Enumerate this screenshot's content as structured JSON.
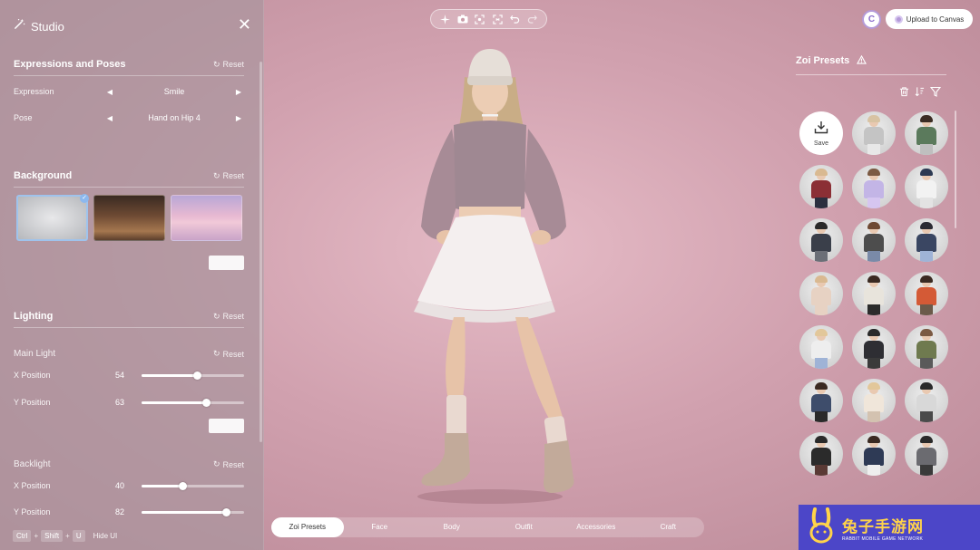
{
  "studio": {
    "title": "Studio",
    "sections": {
      "expressions": {
        "title": "Expressions and Poses",
        "reset": "Reset",
        "expression_label": "Expression",
        "expression_value": "Smile",
        "pose_label": "Pose",
        "pose_value": "Hand on Hip 4"
      },
      "background": {
        "title": "Background",
        "reset": "Reset"
      },
      "lighting": {
        "title": "Lighting",
        "reset": "Reset",
        "main_light": {
          "title": "Main Light",
          "reset": "Reset",
          "x_label": "X Position",
          "x_value": 54,
          "y_label": "Y Position",
          "y_value": 63
        },
        "backlight": {
          "title": "Backlight",
          "reset": "Reset",
          "x_label": "X Position",
          "x_value": 40,
          "y_label": "Y Position",
          "y_value": 82
        }
      }
    },
    "shortcuts": {
      "keys": [
        "Ctrl",
        "Shift",
        "U"
      ],
      "plus": "+",
      "label": "Hide UI"
    }
  },
  "header": {
    "avatar_letter": "C",
    "upload_label": "Upload to Canvas"
  },
  "presets": {
    "title": "Zoi Presets",
    "save_label": "Save",
    "items": [
      {
        "hair": "#d8c3a3",
        "top": "#c4c4c4",
        "bottom": "#e8e8e8"
      },
      {
        "hair": "#3b2c24",
        "top": "#5b7a5c",
        "bottom": "#bfbfbf"
      },
      {
        "hair": "#d9b991",
        "top": "#8b2f35",
        "bottom": "#2b2f3f"
      },
      {
        "hair": "#7b5a43",
        "top": "#c3b5e6",
        "bottom": "#d6c6f0"
      },
      {
        "hair": "#2d3a53",
        "top": "#f2f2f2",
        "bottom": "#e3e3e3"
      },
      {
        "hair": "#2a2a2a",
        "top": "#3a3f4a",
        "bottom": "#6b6f77"
      },
      {
        "hair": "#6e4a33",
        "top": "#4d4d4d",
        "bottom": "#7a8aa8"
      },
      {
        "hair": "#2b2b33",
        "top": "#3a4662",
        "bottom": "#9fb3d6"
      },
      {
        "hair": "#d9b991",
        "top": "#e7d2c3",
        "bottom": "#e7d2c3"
      },
      {
        "hair": "#3a2a22",
        "top": "#e8e4dc",
        "bottom": "#2b2b2b"
      },
      {
        "hair": "#3a2a22",
        "top": "#d45a36",
        "bottom": "#6b5a4a"
      },
      {
        "hair": "#e2c79a",
        "top": "#eeeeee",
        "bottom": "#9fb3d6"
      },
      {
        "hair": "#2a2a2a",
        "top": "#2e2e33",
        "bottom": "#3a3a3a"
      },
      {
        "hair": "#7b5a43",
        "top": "#6f7a4f",
        "bottom": "#5a5a5a"
      },
      {
        "hair": "#3a2a22",
        "top": "#3e4d6b",
        "bottom": "#2a2a2a"
      },
      {
        "hair": "#e2c79a",
        "top": "#f0e6da",
        "bottom": "#d3c2b0"
      },
      {
        "hair": "#2a2a2a",
        "top": "#d8d8d8",
        "bottom": "#4a4a4a"
      },
      {
        "hair": "#2a2a2a",
        "top": "#2b2b2b",
        "bottom": "#5a3a35"
      },
      {
        "hair": "#3a2a22",
        "top": "#2e3a55",
        "bottom": "#eeeeee"
      },
      {
        "hair": "#2a2a2a",
        "top": "#6b6b70",
        "bottom": "#3a3a3a"
      }
    ]
  },
  "tabs": [
    "Zoi Presets",
    "Face",
    "Body",
    "Outfit",
    "Accessories",
    "Craft"
  ],
  "watermark": {
    "cn": "兔子手游网",
    "en": "RABBIT MOBILE GAME NETWORK"
  },
  "colors": {
    "accent": "#b49ad8",
    "selected_border": "#9fc3ec",
    "watermark_bg": "#4c46c8"
  }
}
